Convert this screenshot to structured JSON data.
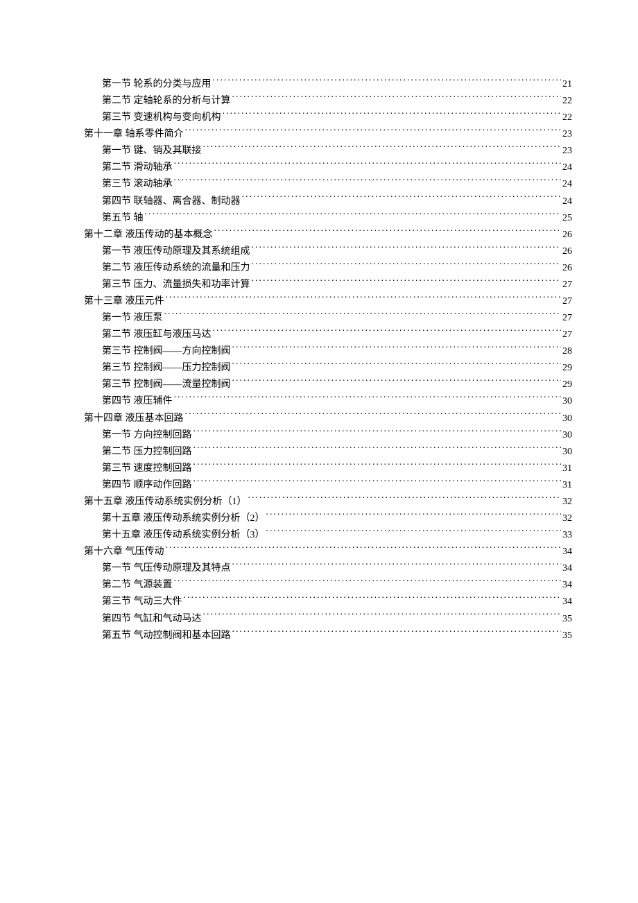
{
  "toc": [
    {
      "level": "section",
      "title": "第一节  轮系的分类与应用",
      "page": "21"
    },
    {
      "level": "section",
      "title": "第二节  定轴轮系的分析与计算",
      "page": "22"
    },
    {
      "level": "section",
      "title": "第三节  变速机构与变向机构",
      "page": "22"
    },
    {
      "level": "chapter",
      "title": "第十一章  轴系零件简介",
      "page": "23"
    },
    {
      "level": "section",
      "title": "第一节  键、销及其联接",
      "page": "23"
    },
    {
      "level": "section",
      "title": "第二节  滑动轴承",
      "page": "24"
    },
    {
      "level": "section",
      "title": "第三节  滚动轴承",
      "page": "24"
    },
    {
      "level": "section",
      "title": "第四节  联轴器、离合器、制动器",
      "page": "24"
    },
    {
      "level": "section",
      "title": "第五节  轴",
      "page": "25"
    },
    {
      "level": "chapter",
      "title": "第十二章  液压传动的基本概念",
      "page": "26"
    },
    {
      "level": "section",
      "title": "第一节  液压传动原理及其系统组成",
      "page": "26"
    },
    {
      "level": "section",
      "title": "第二节  液压传动系统的流量和压力",
      "page": "26"
    },
    {
      "level": "section",
      "title": "第三节  压力、流量损失和功率计算",
      "page": "27"
    },
    {
      "level": "chapter",
      "title": "第十三章  液压元件",
      "page": "27"
    },
    {
      "level": "section",
      "title": "第一节  液压泵",
      "page": "27"
    },
    {
      "level": "section",
      "title": "第二节  液压缸与液压马达",
      "page": "27"
    },
    {
      "level": "section",
      "title": "第三节  控制阀——方向控制阀",
      "page": "28"
    },
    {
      "level": "section",
      "title": "第三节  控制阀——压力控制阀",
      "page": "29"
    },
    {
      "level": "section",
      "title": "第三节  控制阀——流量控制阀",
      "page": "29"
    },
    {
      "level": "section",
      "title": "第四节  液压辅件",
      "page": "30"
    },
    {
      "level": "chapter",
      "title": "第十四章  液压基本回路",
      "page": "30"
    },
    {
      "level": "section",
      "title": "第一节  方向控制回路",
      "page": "30"
    },
    {
      "level": "section",
      "title": "第二节  压力控制回路",
      "page": "30"
    },
    {
      "level": "section",
      "title": "第三节  速度控制回路",
      "page": "31"
    },
    {
      "level": "section",
      "title": "第四节  顺序动作回路",
      "page": "31"
    },
    {
      "level": "chapter",
      "title": "第十五章  液压传动系统实例分析（1）",
      "page": "32"
    },
    {
      "level": "section",
      "title": "第十五章  液压传动系统实例分析（2）",
      "page": "32"
    },
    {
      "level": "section",
      "title": "第十五章  液压传动系统实例分析（3）",
      "page": "33"
    },
    {
      "level": "chapter",
      "title": "第十六章  气压传动",
      "page": "34"
    },
    {
      "level": "section",
      "title": "第一节  气压传动原理及其特点",
      "page": "34"
    },
    {
      "level": "section",
      "title": "第二节  气源装置",
      "page": "34"
    },
    {
      "level": "section",
      "title": "第三节  气动三大件",
      "page": "34"
    },
    {
      "level": "section",
      "title": "第四节  气缸和气动马达",
      "page": "35"
    },
    {
      "level": "section",
      "title": "第五节  气动控制阀和基本回路",
      "page": "35"
    }
  ]
}
